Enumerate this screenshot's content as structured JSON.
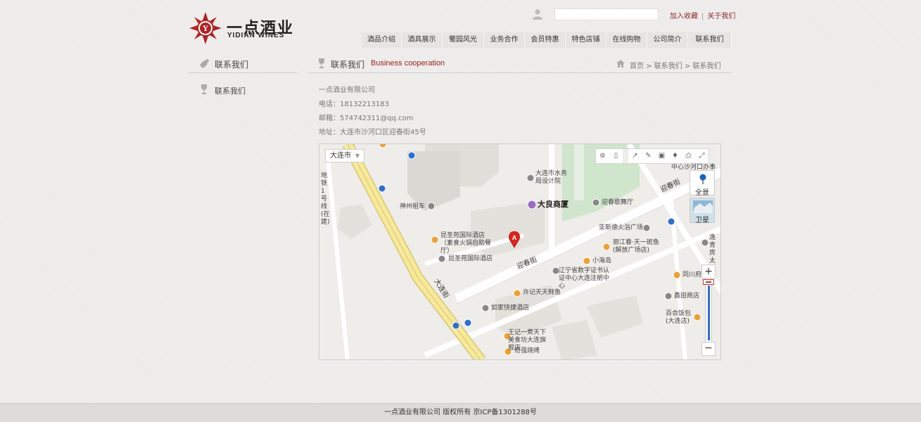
{
  "brand": {
    "name_cn": "一点酒业",
    "name_en": "YIDIAN WINES"
  },
  "header": {
    "search_value": "",
    "links": [
      "加入收藏",
      "关于我们"
    ]
  },
  "nav": {
    "items": [
      "酒品介绍",
      "酒具展示",
      "葡园风光",
      "业务合作",
      "会员特惠",
      "特色店铺",
      "在线购物",
      "公司简介",
      "联系我们"
    ]
  },
  "sidebar": {
    "title": "联系我们",
    "items": [
      {
        "label": "联系我们"
      }
    ]
  },
  "main": {
    "title_cn": "联系我们",
    "title_en": "Business cooperation",
    "breadcrumb": "首页 > 联系我们 > 联系我们",
    "company": "一点酒业有限公司",
    "phone": "电话：18132213183",
    "email": "邮箱：574742311@qq.com",
    "address": "地址：大连市沙河口区迎春街45号"
  },
  "map": {
    "city_select": "大连市",
    "btn_panorama": "全景",
    "btn_satellite": "卫星",
    "zoom_in": "+",
    "zoom_out": "−",
    "marker": "A",
    "labels": {
      "metro": "地铁1号线(在建)",
      "water_bureau": "大连市水务局设计院",
      "shenzhou": "神州租车",
      "daliang": "大良商厦",
      "yingchun_dance": "迎春歌舞厅",
      "kunsheng_rest": "昆圣苑国际酒店（素食火锅自助餐厅）",
      "kunsheng_hotel": "昆圣苑国际酒店",
      "yasi": "亚斯德火浴广场",
      "lijiang": "丽江春·天一斑鱼(解放广场店)",
      "xiaohaidao": "小海岛",
      "yingchun_st1": "迎春街",
      "yingchun_st2": "迎春街",
      "liaoning": "辽宁省数字证书认证中心大连注册中心",
      "tongchuan": "同川府",
      "dalian_st": "大连街",
      "xuji": "许记天天鲜鱼",
      "xintian": "鑫田商店",
      "rujia": "如家快捷酒店",
      "baihe": "百合饭包(大连店)",
      "wangji": "王记一煮天下美食坊大连旗舰店",
      "qiqiang": "奇强烧烤",
      "shahekou_office": "中心沙河口办事",
      "yishang": "逸青房太"
    }
  },
  "footer": {
    "text": "一点酒业有限公司 版权所有 京ICP备1301288号"
  },
  "colors": {
    "accent": "#9b1b1b",
    "link": "#8a2a2a",
    "map_road": "#f6e99a"
  }
}
